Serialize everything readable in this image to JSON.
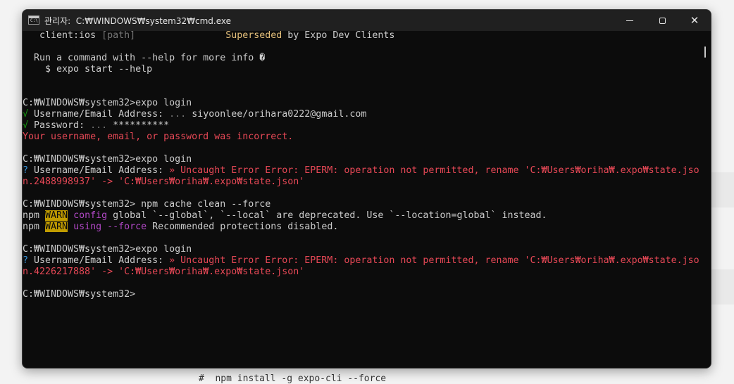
{
  "window": {
    "title": "관리자:  C:₩WINDOWS₩system32₩cmd.exe",
    "icon": "cmd-app-icon"
  },
  "controls": {
    "minimize": "minimize-icon",
    "maximize": "maximize-icon",
    "close": "close-icon"
  },
  "console": {
    "l1": {
      "a": "   client:ios ",
      "b": "[path]",
      "c": "                ",
      "d": "Superseded",
      "e": " by Expo Dev Clients"
    },
    "l2": "",
    "l3": "  Run a command with --help for more info �",
    "l4": "    $ expo start --help",
    "l5": "",
    "l6": "",
    "l7": "C:₩WINDOWS₩system32>expo login",
    "l8": {
      "a": "√",
      "b": " Username/Email Address: ",
      "c": "...",
      "d": " siyoonlee/orihara0222@gmail.com"
    },
    "l9": {
      "a": "√",
      "b": " Password: ",
      "c": "...",
      "d": " **********"
    },
    "l10": "Your username, email, or password was incorrect.",
    "l11": "",
    "l12": "C:₩WINDOWS₩system32>expo login",
    "l13": {
      "a": "?",
      "b": " Username/Email Address: ",
      "c": "» Uncaught Error Error: EPERM: operation not permitted, rename 'C:₩Users₩oriha₩.expo₩state.jso"
    },
    "l14": "n.2488998937' -> 'C:₩Users₩oriha₩.expo₩state.json'",
    "l15": "",
    "l16": "C:₩WINDOWS₩system32> npm cache clean --force",
    "l17": {
      "a": "npm ",
      "b": "WARN",
      "c": " ",
      "d": "config",
      "e": " global `--global`, `--local` are deprecated. Use `--location=global` instead."
    },
    "l18": {
      "a": "npm ",
      "b": "WARN",
      "c": " ",
      "d": "using --force",
      "e": " Recommended protections disabled."
    },
    "l19": "",
    "l20": "C:₩WINDOWS₩system32>expo login",
    "l21": {
      "a": "?",
      "b": " Username/Email Address: ",
      "c": "» Uncaught Error Error: EPERM: operation not permitted, rename 'C:₩Users₩oriha₩.expo₩state.jso"
    },
    "l22": "n.4226217888' -> 'C:₩Users₩oriha₩.expo₩state.json'",
    "l23": "",
    "l24": "C:₩WINDOWS₩system32>"
  },
  "background": {
    "bottom_text": "#  npm install -g expo-cli --force"
  },
  "colors": {
    "console_bg": "#0c0c0c",
    "console_fg": "#cccccc",
    "titlebar": "#202020",
    "green": "#13a10e",
    "red": "#e74856",
    "cyan": "#3a96dd",
    "magenta": "#b148c6",
    "warn_bg": "#c19c00",
    "superseded": "#e5c07b"
  }
}
